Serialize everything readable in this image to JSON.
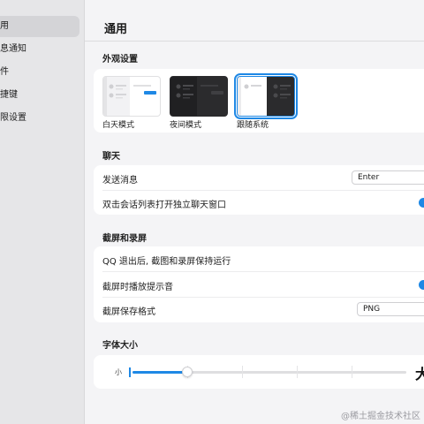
{
  "sidebar": {
    "items": [
      {
        "label": "用",
        "active": true
      },
      {
        "label": "息通知",
        "active": false
      },
      {
        "label": "件",
        "active": false
      },
      {
        "label": "捷键",
        "active": false
      },
      {
        "label": "限设置",
        "active": false
      }
    ]
  },
  "header": {
    "title": "通用"
  },
  "appearance": {
    "section_title": "外观设置",
    "themes": [
      {
        "label": "白天模式",
        "selected": false
      },
      {
        "label": "夜间模式",
        "selected": false
      },
      {
        "label": "跟随系统",
        "selected": true
      }
    ]
  },
  "chat": {
    "section_title": "聊天",
    "send_message_label": "发送消息",
    "send_message_value": "Enter",
    "double_click_label": "双击会话列表打开独立聊天窗口",
    "double_click_enabled": true
  },
  "screenshot": {
    "section_title": "截屏和录屏",
    "keep_running_label": "QQ 退出后, 截图和录屏保持运行",
    "keep_running_enabled": false,
    "play_sound_label": "截屏时播放提示音",
    "play_sound_enabled": true,
    "format_label": "截屏保存格式",
    "format_value": "PNG"
  },
  "font_size": {
    "section_title": "字体大小",
    "small_label": "小",
    "large_label": "大",
    "level_fraction": 0.2
  },
  "watermark": "@稀土掘金技术社区",
  "colors": {
    "accent": "#1e88e5",
    "sidebar_bg": "#e6e6e8",
    "page_bg": "#f4f4f6"
  }
}
